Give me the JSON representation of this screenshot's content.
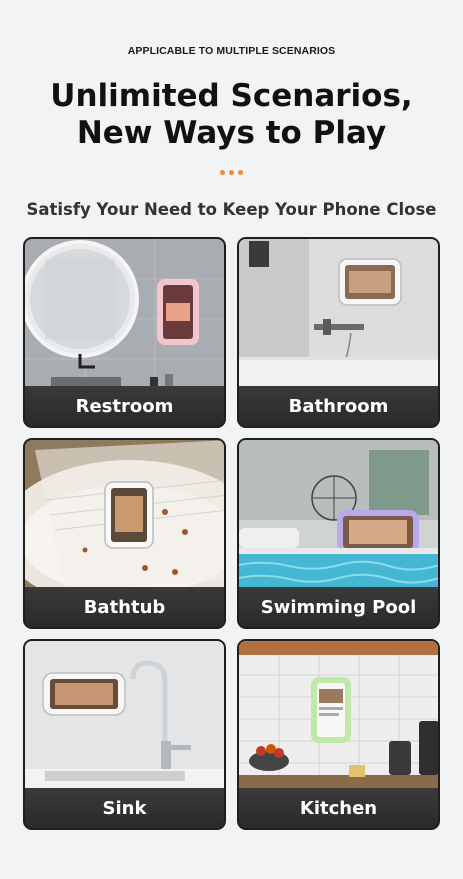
{
  "header": {
    "eyebrow": "APPLICABLE TO MULTIPLE SCENARIOS",
    "title_line1": "Unlimited Scenarios,",
    "title_line2": "New Ways to Play",
    "subtitle": "Satisfy Your Need to Keep Your Phone Close"
  },
  "accent_color": "#f08a3c",
  "scenarios": [
    {
      "label": "Restroom",
      "icon": "restroom-scene"
    },
    {
      "label": "Bathroom",
      "icon": "bathroom-scene"
    },
    {
      "label": "Bathtub",
      "icon": "bathtub-scene"
    },
    {
      "label": "Swimming Pool",
      "icon": "swimming-pool-scene"
    },
    {
      "label": "Sink",
      "icon": "sink-scene"
    },
    {
      "label": "Kitchen",
      "icon": "kitchen-scene"
    }
  ]
}
